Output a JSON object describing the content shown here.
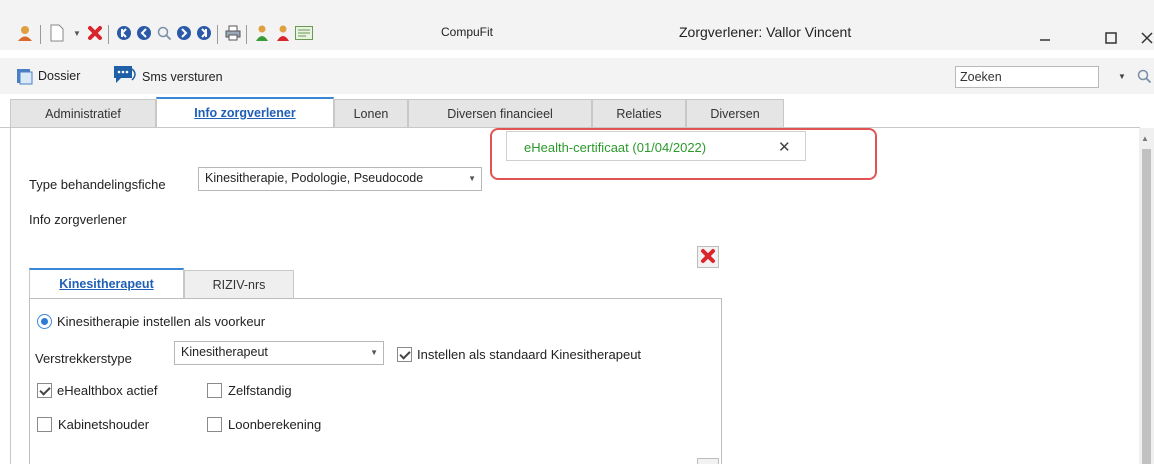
{
  "window": {
    "title": "Zorgverlener: Vallor Vincent",
    "app_label": "CompuFit"
  },
  "toolbar": {
    "dossier_label": "Dossier",
    "sms_label": "Sms versturen",
    "search_placeholder": "Zoeken"
  },
  "tabs": [
    {
      "label": "Administratief"
    },
    {
      "label": "Info zorgverlener"
    },
    {
      "label": "Lonen"
    },
    {
      "label": "Diversen financieel"
    },
    {
      "label": "Relaties"
    },
    {
      "label": "Diversen"
    }
  ],
  "certificate": {
    "label": "eHealth-certificaat (01/04/2022)",
    "close": "✕"
  },
  "form": {
    "type_label": "Type behandelingsfiche",
    "type_value": "Kinesitherapie, Podologie, Pseudocode",
    "section_label": "Info zorgverlener"
  },
  "inner_tabs": [
    {
      "label": "Kinesitherapeut"
    },
    {
      "label": "RIZIV-nrs"
    }
  ],
  "kine": {
    "radio_label": "Kinesitherapie instellen als voorkeur",
    "verstrekker_label": "Verstrekkerstype",
    "verstrekker_value": "Kinesitherapeut",
    "standaard_label": "Instellen als standaard Kinesitherapeut",
    "ehealthbox_label": "eHealthbox actief",
    "zelfstandig_label": "Zelfstandig",
    "kabinet_label": "Kabinetshouder",
    "loon_label": "Loonberekening"
  },
  "colors": {
    "accent": "#3c86d8",
    "cert_green": "#2b9a2b",
    "highlight_red": "#e25454"
  }
}
